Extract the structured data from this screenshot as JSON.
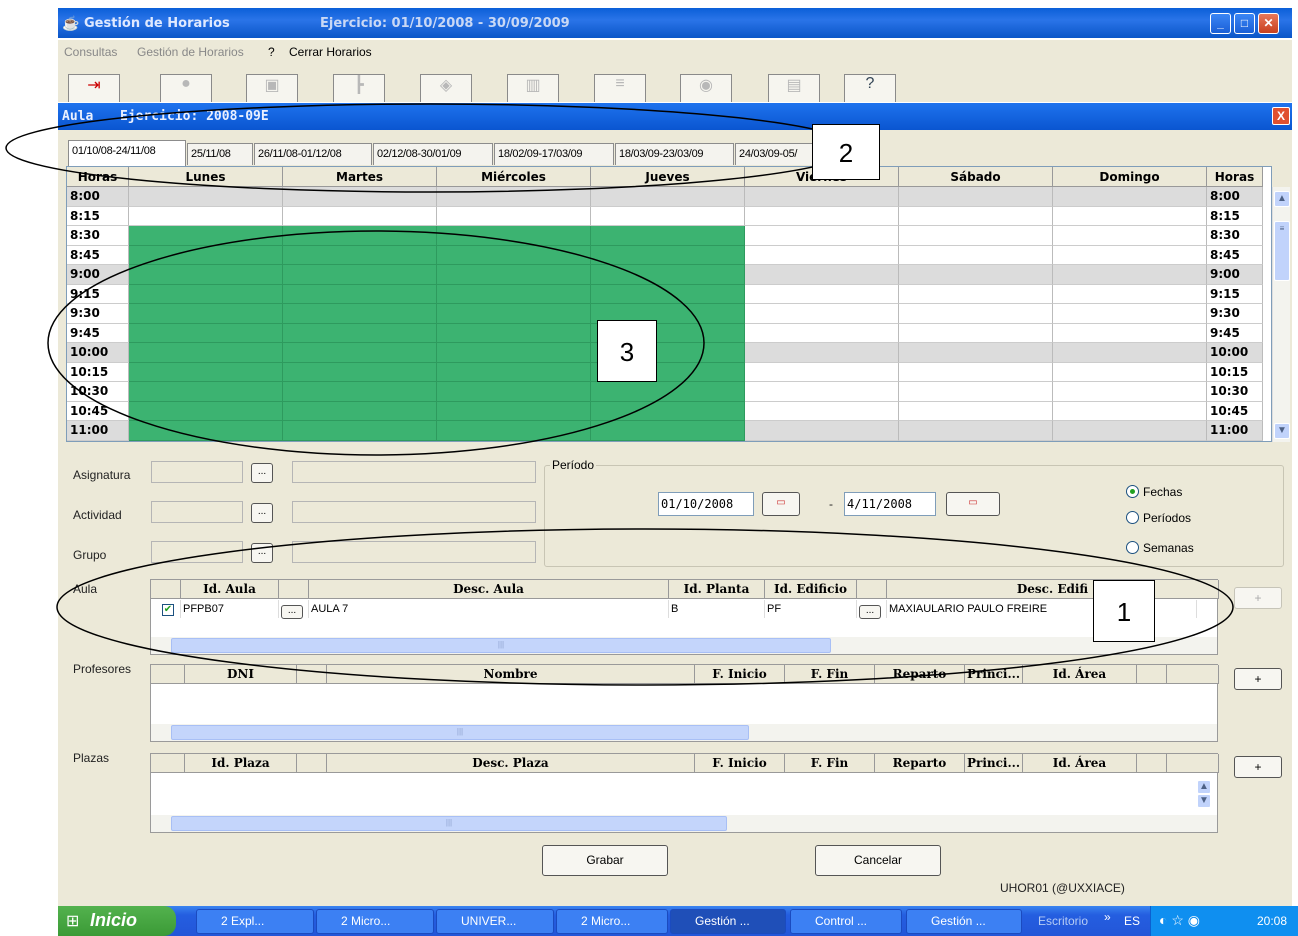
{
  "window": {
    "title": "Gestión de Horarios",
    "ejercicio": "Ejercicio: 01/10/2008  -  30/09/2009"
  },
  "menu": [
    "Consultas",
    "Gestión de Horarios",
    "?",
    "Cerrar Horarios"
  ],
  "dialog": {
    "title": "Aula",
    "ejercicio": "Ejercicio: 2008-09E",
    "close": "X"
  },
  "tabs": [
    "01/10/08-24/11/08",
    "25/11/08",
    "26/11/08-01/12/08",
    "02/12/08-30/01/09",
    "18/02/09-17/03/09",
    "18/03/09-23/03/09",
    "24/03/09-05/"
  ],
  "grid": {
    "headers": [
      "Horas",
      "Lunes",
      "Martes",
      "Miércoles",
      "Jueves",
      "Viernes",
      "Sábado",
      "Domingo",
      "Horas"
    ],
    "times": [
      "8:00",
      "8:15",
      "8:30",
      "8:45",
      "9:00",
      "9:15",
      "9:30",
      "9:45",
      "10:00",
      "10:15",
      "10:30",
      "10:45",
      "11:00"
    ],
    "occupied_color": "#3cb371"
  },
  "form": {
    "asignatura_label": "Asignatura",
    "actividad_label": "Actividad",
    "grupo_label": "Grupo",
    "dots": "...",
    "periodo_label": "Período",
    "fecha_desde": "01/10/2008",
    "separator": "-",
    "fecha_hasta": "4/11/2008",
    "radio_fechas": "Fechas",
    "radio_periodos": "Períodos",
    "radio_semanas": "Semanas",
    "selected_radio": "Fechas"
  },
  "aula": {
    "label": "Aula",
    "headers": [
      "Id. Aula",
      "Desc. Aula",
      "Id. Planta",
      "Id. Edificio",
      "Desc. Edifi"
    ],
    "row": {
      "checked": true,
      "id_aula": "PFPB07",
      "desc_aula": "AULA 7",
      "id_planta": "B",
      "id_edificio": "PF",
      "desc_edificio": "MAXIAULARIO PAULO FREIRE"
    },
    "add": "+"
  },
  "profesores": {
    "label": "Profesores",
    "headers": [
      "DNI",
      "Nombre",
      "F. Inicio",
      "F. Fin",
      "Reparto",
      "Princi...",
      "Id. Área"
    ],
    "add": "+"
  },
  "plazas": {
    "label": "Plazas",
    "headers": [
      "Id. Plaza",
      "Desc. Plaza",
      "F. Inicio",
      "F. Fin",
      "Reparto",
      "Princi...",
      "Id. Área"
    ],
    "add": "+"
  },
  "buttons": {
    "grabar": "Grabar",
    "cancelar": "Cancelar"
  },
  "status": "UHOR01 (@UXXIACE)",
  "annotations": [
    "1",
    "2",
    "3"
  ],
  "taskbar": {
    "start": "Inicio",
    "tasks": [
      "2 Expl...",
      "2 Micro...",
      "UNIVER...",
      "2 Micro...",
      "Gestión ...",
      "Control ...",
      "Gestión ..."
    ],
    "escritorio": "Escritorio",
    "lang": "ES",
    "clock": "20:08"
  }
}
